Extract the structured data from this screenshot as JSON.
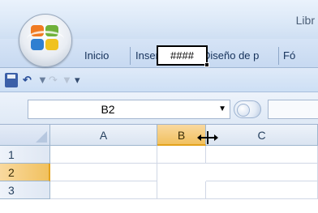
{
  "window": {
    "title": "Libr"
  },
  "ribbon": {
    "tabs": [
      {
        "label": "Inicio"
      },
      {
        "label": "Insertar"
      },
      {
        "label": "Diseño de p"
      },
      {
        "label": "Fó"
      }
    ]
  },
  "quick_access": {
    "icons": [
      "save-icon",
      "undo-icon",
      "redo-icon",
      "customize-qat-icon"
    ]
  },
  "formula_bar": {
    "name_box_value": "B2"
  },
  "sheet": {
    "columns": [
      "A",
      "B",
      "C"
    ],
    "rows": [
      "1",
      "2",
      "3"
    ],
    "selected_column": "B",
    "selected_row": "2",
    "active_cell_display": "####"
  },
  "colors": {
    "selected_header": "#f1c15f",
    "header_bg": "#dae4f1",
    "ribbon_bg": "#c7d9f1",
    "office_orange": "#f07b22",
    "office_green": "#6fb13a",
    "office_blue": "#2f7fd1",
    "office_yellow": "#f0c21f"
  }
}
